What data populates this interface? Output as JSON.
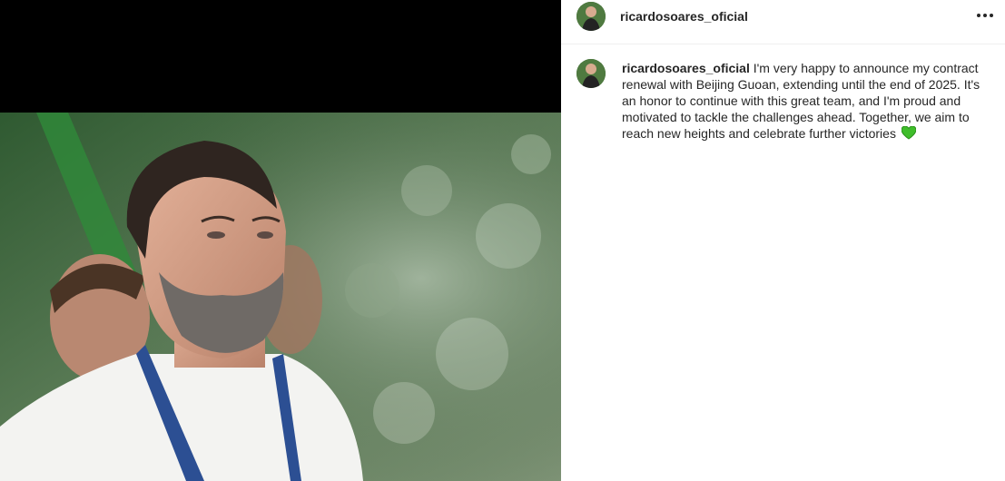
{
  "post": {
    "username": "ricardosoares_oficial",
    "caption_user": "ricardosoares_oficial",
    "caption_text": " I'm very happy to announce my contract renewal with Beijing Guoan, extending until the end of 2025. It's an honor to continue with this great team, and I'm proud and motivated to tackle the challenges ahead. Together, we aim to reach new heights and celebrate further victories ",
    "more_options_icon": "more-horizontal-icon",
    "caption_emoji_icon": "green-heart-icon"
  },
  "colors": {
    "accent": "#262626",
    "divider": "#efefef",
    "emoji": "#3fbd2b"
  }
}
